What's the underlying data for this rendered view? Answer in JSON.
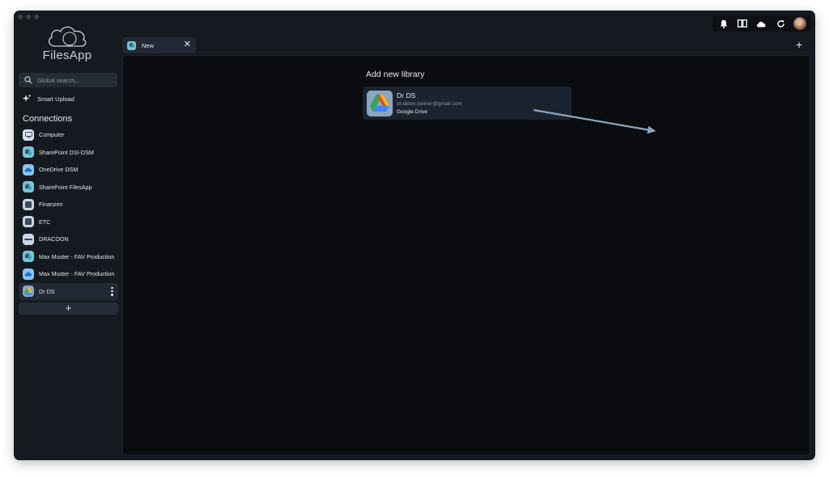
{
  "app": {
    "name": "FilesApp"
  },
  "search": {
    "placeholder": "Global search..."
  },
  "smart_upload": {
    "label": "Smart Upload"
  },
  "connections": {
    "title": "Connections",
    "items": [
      {
        "label": "Computer",
        "icon": "computer-icon",
        "color": "#d7e4ef"
      },
      {
        "label": "SharePoint DSI-DSM",
        "icon": "sharepoint-icon",
        "color": "#7fc4d4"
      },
      {
        "label": "OneDrive DSM",
        "icon": "onedrive-icon",
        "color": "#8cc4f0"
      },
      {
        "label": "SharePoint FilesApp",
        "icon": "sharepoint-icon",
        "color": "#7fc4d4"
      },
      {
        "label": "Finanzen",
        "icon": "server-icon",
        "color": "#c9d6e3"
      },
      {
        "label": "ETC",
        "icon": "server-icon",
        "color": "#c9d6e3"
      },
      {
        "label": "DRACOON",
        "icon": "dracoon-icon",
        "color": "#c9d6e3"
      },
      {
        "label": "Max Muster - FAV Production",
        "icon": "sharepoint-icon",
        "color": "#7fc4d4"
      },
      {
        "label": "Max Muster - FAV Production",
        "icon": "onedrive-icon",
        "color": "#8cc4f0"
      },
      {
        "label": "Dr DS",
        "icon": "google-drive-icon",
        "color": "#8aa6c2",
        "active": true
      }
    ],
    "add_label": "+"
  },
  "tabs": [
    {
      "label": "New",
      "close": "✕"
    }
  ],
  "tab_add": "+",
  "main": {
    "title": "Add new library",
    "library": {
      "name": "Dr DS",
      "email": "dr.dieter.steiner@gmail.com",
      "type": "Google Drive"
    }
  },
  "colors": {
    "window_bg": "#151a21",
    "panel_bg": "#0a0c10",
    "card_bg": "#1b2330",
    "arrow": "#8aa6c2"
  }
}
